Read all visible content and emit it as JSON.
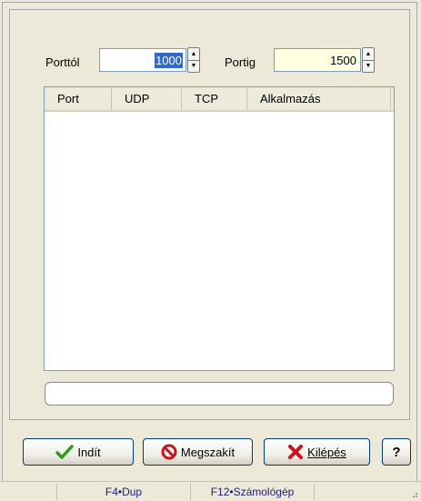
{
  "filter": {
    "from_label": "Porttól",
    "from_value": "1000",
    "to_label": "Portig",
    "to_value": "1500"
  },
  "table": {
    "columns": [
      "Port",
      "UDP",
      "TCP",
      "Alkalmazás"
    ],
    "rows": []
  },
  "buttons": {
    "start": "Indít",
    "cancel": "Megszakít",
    "exit": "Kilépés",
    "help": "?"
  },
  "status": {
    "shortcut_1": "F4•Dup",
    "shortcut_2": "F12•Számológép"
  },
  "icons": {
    "start": "checkmark-icon",
    "cancel": "no-entry-icon",
    "exit": "red-x-icon"
  },
  "colors": {
    "selection": "#316ac5",
    "highlight_field": "#ffffe1",
    "check_green": "#2f9a16",
    "cancel_red": "#c8141e"
  }
}
